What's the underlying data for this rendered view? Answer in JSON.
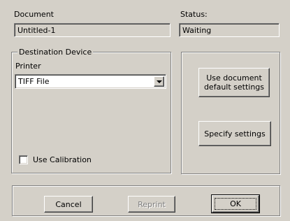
{
  "document": {
    "label": "Document",
    "value": "Untitled-1"
  },
  "status": {
    "label": "Status:",
    "value": "Waiting"
  },
  "destination": {
    "legend": "Destination Device",
    "printer_label": "Printer",
    "printer_value": "TIFF File",
    "use_calibration_label": "Use Calibration",
    "use_calibration_checked": false
  },
  "settings": {
    "use_default_label": "Use document default settings",
    "specify_label": "Specify settings"
  },
  "footer": {
    "cancel_label": "Cancel",
    "reprint_label": "Reprint",
    "reprint_enabled": false,
    "ok_label": "OK"
  }
}
